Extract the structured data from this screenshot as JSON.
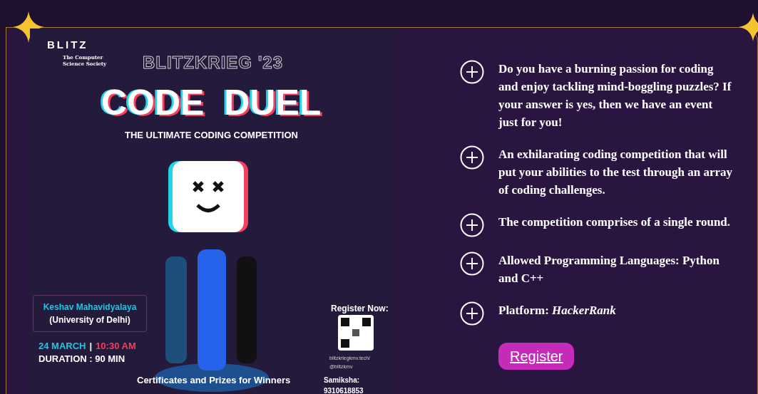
{
  "poster": {
    "brand": "BLITZ",
    "society": "The Computer Science Society",
    "event": "BLITZKRIEG '23",
    "title": "CODE  DUEL",
    "subtitle": "THE ULTIMATE CODING COMPETITION",
    "venue_name": "Keshav Mahavidyalaya",
    "venue_university": "(University of Delhi)",
    "date": "24 MARCH",
    "separator": "|",
    "time": "10:30 AM",
    "duration": "DURATION : 90 MIN",
    "register_heading": "Register Now:",
    "website": "blitzkriegkmv.tech/",
    "handle": "@blitzkmv",
    "contact": "Samiksha: 9310618853",
    "footer": "Certificates and Prizes for Winners"
  },
  "features": [
    {
      "text": "Do you have a burning passion for coding and enjoy tackling mind-boggling puzzles? If your answer is yes, then we have an event just for you!"
    },
    {
      "text": "An exhilarating coding competition that will put your abilities to the test through an array of coding challenges."
    },
    {
      "text": "The competition comprises of a single round."
    },
    {
      "text": "Allowed Programming Languages: Python and C++"
    },
    {
      "text": "Platform: *HackerRank*"
    }
  ],
  "register_button": "Register"
}
